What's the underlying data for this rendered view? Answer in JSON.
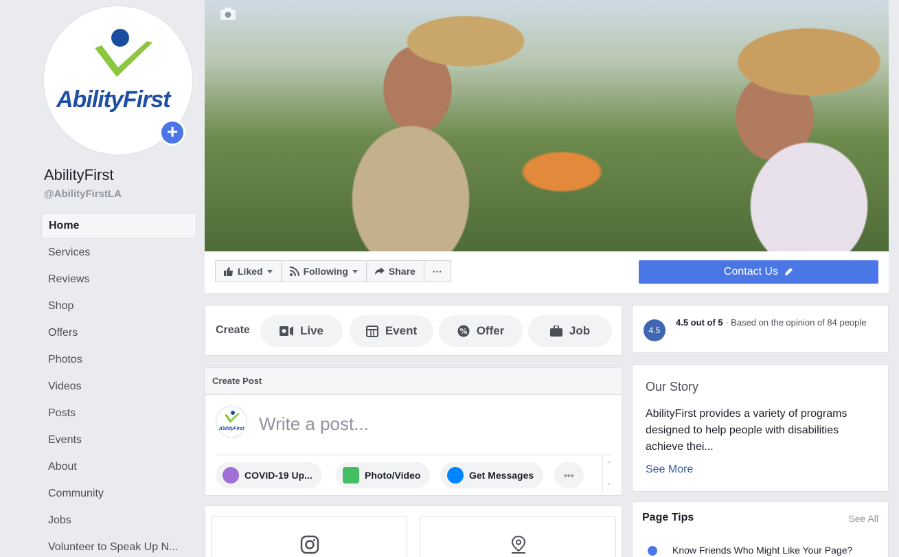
{
  "page": {
    "name": "AbilityFirst",
    "handle": "@AbilityFirstLA",
    "logo_text": "AbilityFirst"
  },
  "sidebar": {
    "items": [
      {
        "label": "Home"
      },
      {
        "label": "Services"
      },
      {
        "label": "Reviews"
      },
      {
        "label": "Shop"
      },
      {
        "label": "Offers"
      },
      {
        "label": "Photos"
      },
      {
        "label": "Videos"
      },
      {
        "label": "Posts"
      },
      {
        "label": "Events"
      },
      {
        "label": "About"
      },
      {
        "label": "Community"
      },
      {
        "label": "Jobs"
      },
      {
        "label": "Volunteer to Speak Up N..."
      }
    ]
  },
  "actions": {
    "liked": "Liked",
    "following": "Following",
    "share": "Share",
    "more": "···",
    "contact": "Contact Us"
  },
  "create": {
    "label": "Create",
    "live": "Live",
    "event": "Event",
    "offer": "Offer",
    "job": "Job"
  },
  "post": {
    "header": "Create Post",
    "placeholder": "Write a post...",
    "avatar_text": "AbilityFirst",
    "chip_covid": "COVID-19 Up...",
    "chip_photo": "Photo/Video",
    "chip_messages": "Get Messages",
    "chip_more": "•••"
  },
  "rating": {
    "badge": "4.5",
    "score": "4.5 out of 5",
    "detail": " · Based on the opinion of 84 people"
  },
  "story": {
    "title": "Our Story",
    "body": "AbilityFirst provides a variety of programs designed to help people with disabilities achieve thei...",
    "more": "See More"
  },
  "tips": {
    "title": "Page Tips",
    "see_all": "See All",
    "item": "Know Friends Who Might Like Your Page?"
  },
  "colors": {
    "brand_blue": "#4a76e6",
    "facebook_blue": "#4267b2",
    "logo_green": "#8cc63f"
  }
}
